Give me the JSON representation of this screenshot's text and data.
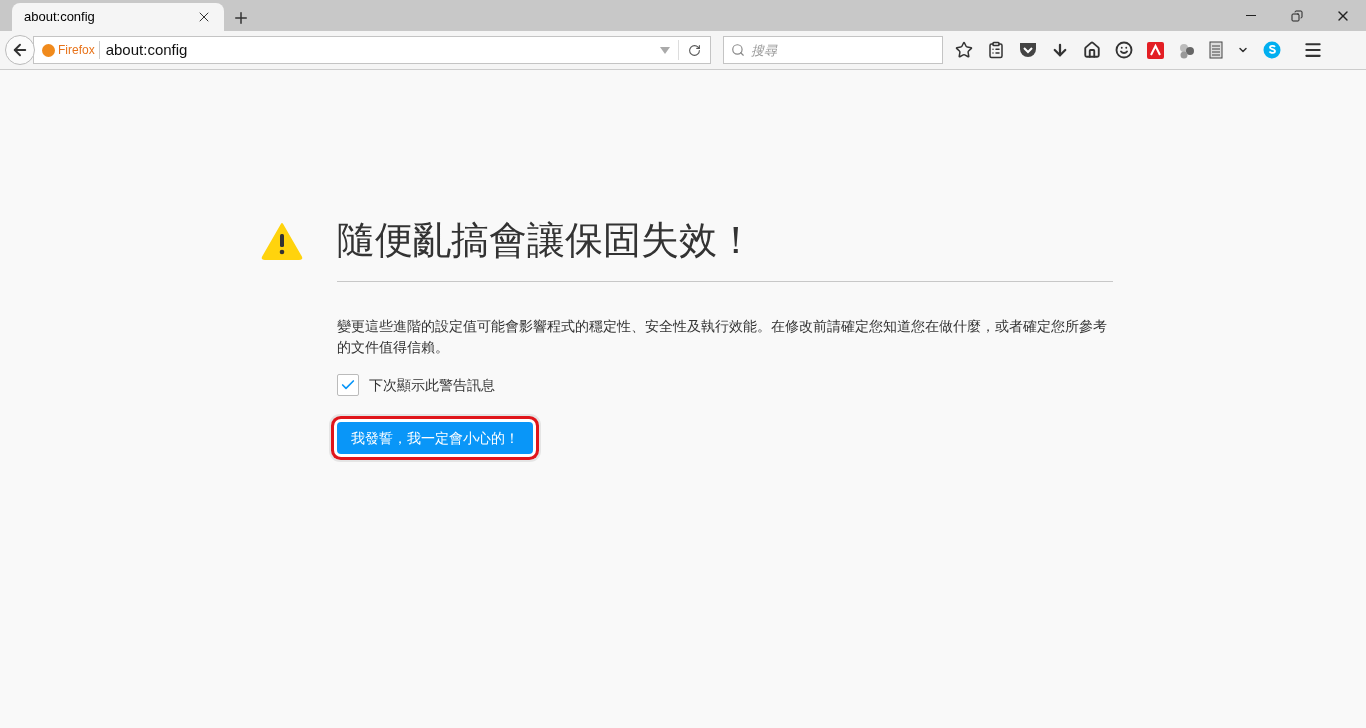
{
  "tabs": [
    {
      "title": "about:config",
      "selected": true
    }
  ],
  "urlbar": {
    "identity": "Firefox",
    "url": "about:config"
  },
  "search": {
    "placeholder": "搜尋"
  },
  "page": {
    "title": "隨便亂搞會讓保固失效！",
    "message": "變更這些進階的設定值可能會影響程式的穩定性、安全性及執行效能。在修改前請確定您知道您在做什麼，或者確定您所參考的文件值得信賴。",
    "checkbox": {
      "label": "下次顯示此警告訊息",
      "checked": true
    },
    "button": {
      "label": "我發誓，我一定會小心的！",
      "highlighted": true
    }
  }
}
